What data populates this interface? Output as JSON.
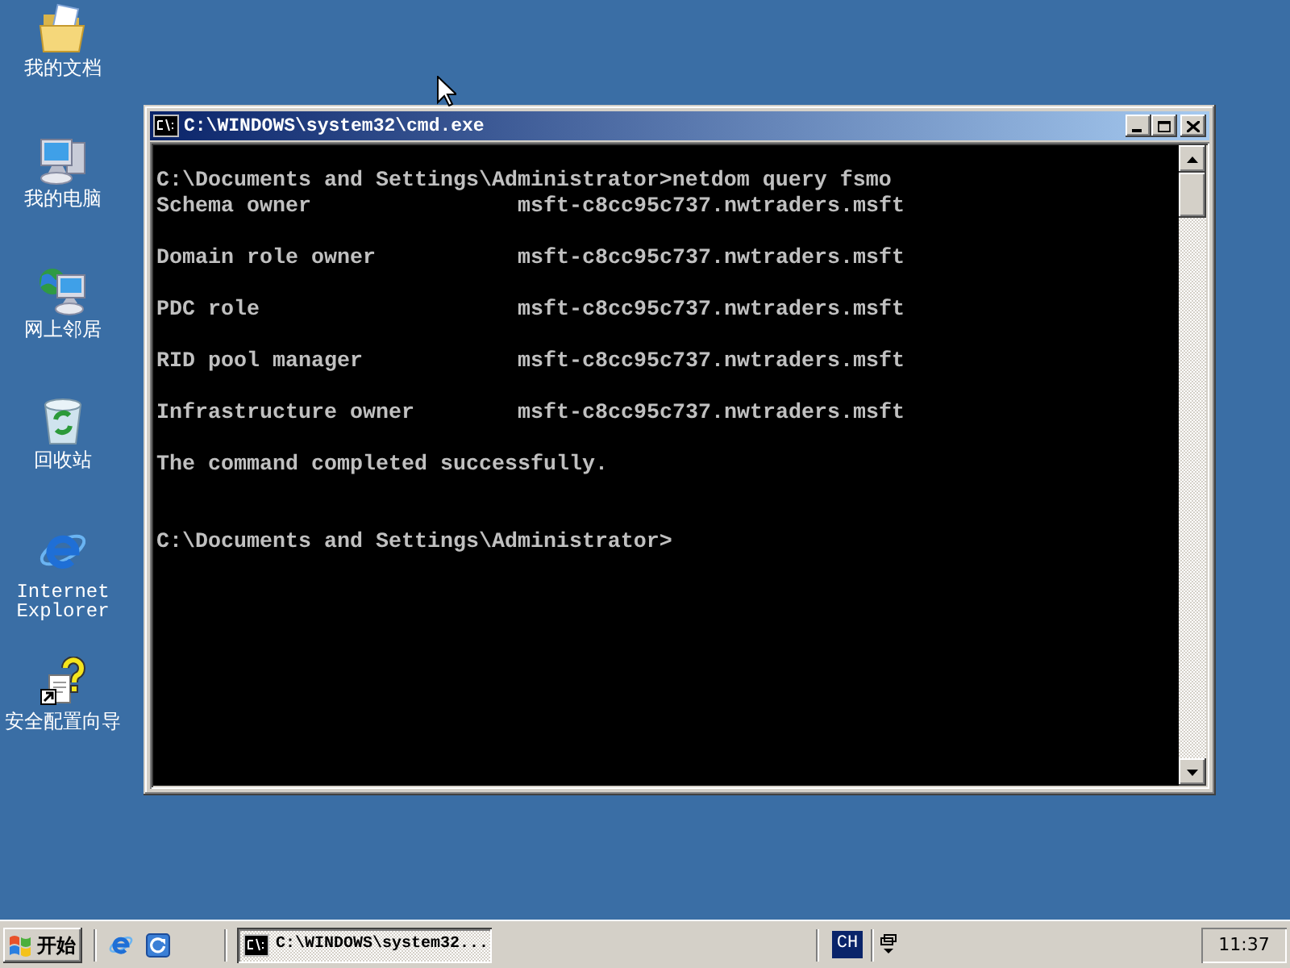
{
  "desktop_icons": [
    {
      "label": "我的文档",
      "kind": "documents"
    },
    {
      "label": "我的电脑",
      "kind": "computer"
    },
    {
      "label": "网上邻居",
      "kind": "network"
    },
    {
      "label": "回收站",
      "kind": "recycle_bin"
    },
    {
      "label": "Internet Explorer",
      "kind": "browser"
    },
    {
      "label": "安全配置向导",
      "kind": "wizard"
    }
  ],
  "window": {
    "title": "C:\\WINDOWS\\system32\\cmd.exe"
  },
  "console": {
    "command_line": "C:\\Documents and Settings\\Administrator>netdom query fsmo",
    "roles": [
      {
        "role": "Schema owner",
        "holder": "msft-c8cc95c737.nwtraders.msft"
      },
      {
        "role": "Domain role owner",
        "holder": "msft-c8cc95c737.nwtraders.msft"
      },
      {
        "role": "PDC role",
        "holder": "msft-c8cc95c737.nwtraders.msft"
      },
      {
        "role": "RID pool manager",
        "holder": "msft-c8cc95c737.nwtraders.msft"
      },
      {
        "role": "Infrastructure owner",
        "holder": "msft-c8cc95c737.nwtraders.msft"
      }
    ],
    "message": "The command completed successfully.",
    "prompt": "C:\\Documents and Settings\\Administrator>"
  },
  "taskbar": {
    "start_button": "开始",
    "task_buttons": [
      {
        "label": "C:\\WINDOWS\\system32...",
        "selected": true
      }
    ],
    "language": "CH",
    "clock": "11:37"
  }
}
